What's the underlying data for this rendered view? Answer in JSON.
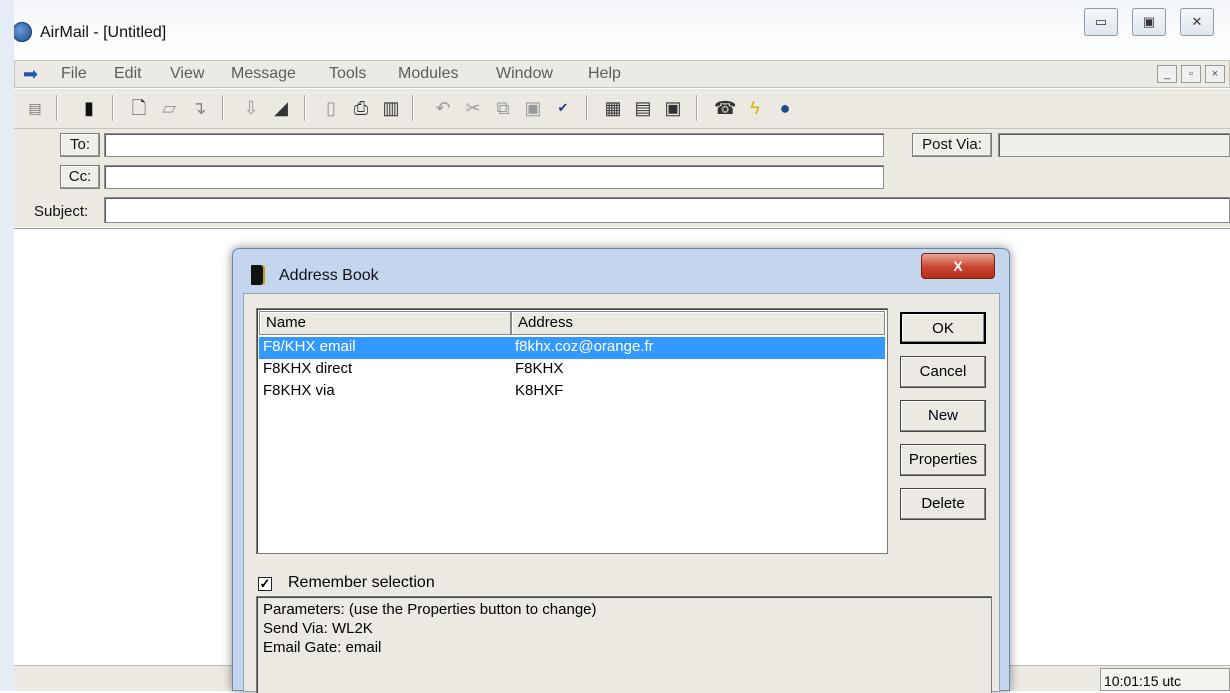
{
  "window": {
    "title": "AirMail - [Untitled]",
    "controls": [
      "minimize",
      "maximize",
      "close"
    ]
  },
  "menubar": {
    "items": [
      "File",
      "Edit",
      "View",
      "Message",
      "Tools",
      "Modules",
      "Window",
      "Help"
    ],
    "mdi_controls": [
      "_",
      "▫",
      "×"
    ]
  },
  "toolbar": {
    "icons": [
      "list-view-icon",
      "address-book-icon",
      "new-message-icon",
      "open-folder-icon",
      "reply-icon",
      "outbox-icon",
      "eraser-icon",
      "copy-form-icon",
      "print-icon",
      "delete-icon",
      "undo-icon",
      "cut-icon",
      "copy-icon",
      "paste-icon",
      "spellcheck-icon",
      "window-layout-1-icon",
      "window-layout-2-icon",
      "window-layout-3-icon",
      "connect-icon",
      "lightning-icon",
      "globe-icon"
    ]
  },
  "fields": {
    "to_label": "To:",
    "cc_label": "Cc:",
    "subject_label": "Subject:",
    "post_via_label": "Post Via:",
    "to_value": "",
    "cc_value": "",
    "subject_value": "",
    "post_via_value": ""
  },
  "status": {
    "time": "10:01:15 utc"
  },
  "dialog": {
    "title": "Address Book",
    "close_label": "X",
    "columns": [
      "Name",
      "Address"
    ],
    "rows": [
      {
        "name": "F8/KHX email",
        "address": "f8khx.coz@orange.fr",
        "selected": true
      },
      {
        "name": "F8KHX direct",
        "address": "F8KHX",
        "selected": false
      },
      {
        "name": "F8KHX via",
        "address": "K8HXF",
        "selected": false
      }
    ],
    "buttons": {
      "ok": "OK",
      "cancel": "Cancel",
      "new": "New",
      "properties": "Properties",
      "delete": "Delete"
    },
    "remember_label": "Remember selection",
    "remember_checked": true,
    "parameters": [
      "Parameters: (use the Properties button to change)",
      "Send Via: WL2K",
      "Email Gate: email"
    ]
  }
}
